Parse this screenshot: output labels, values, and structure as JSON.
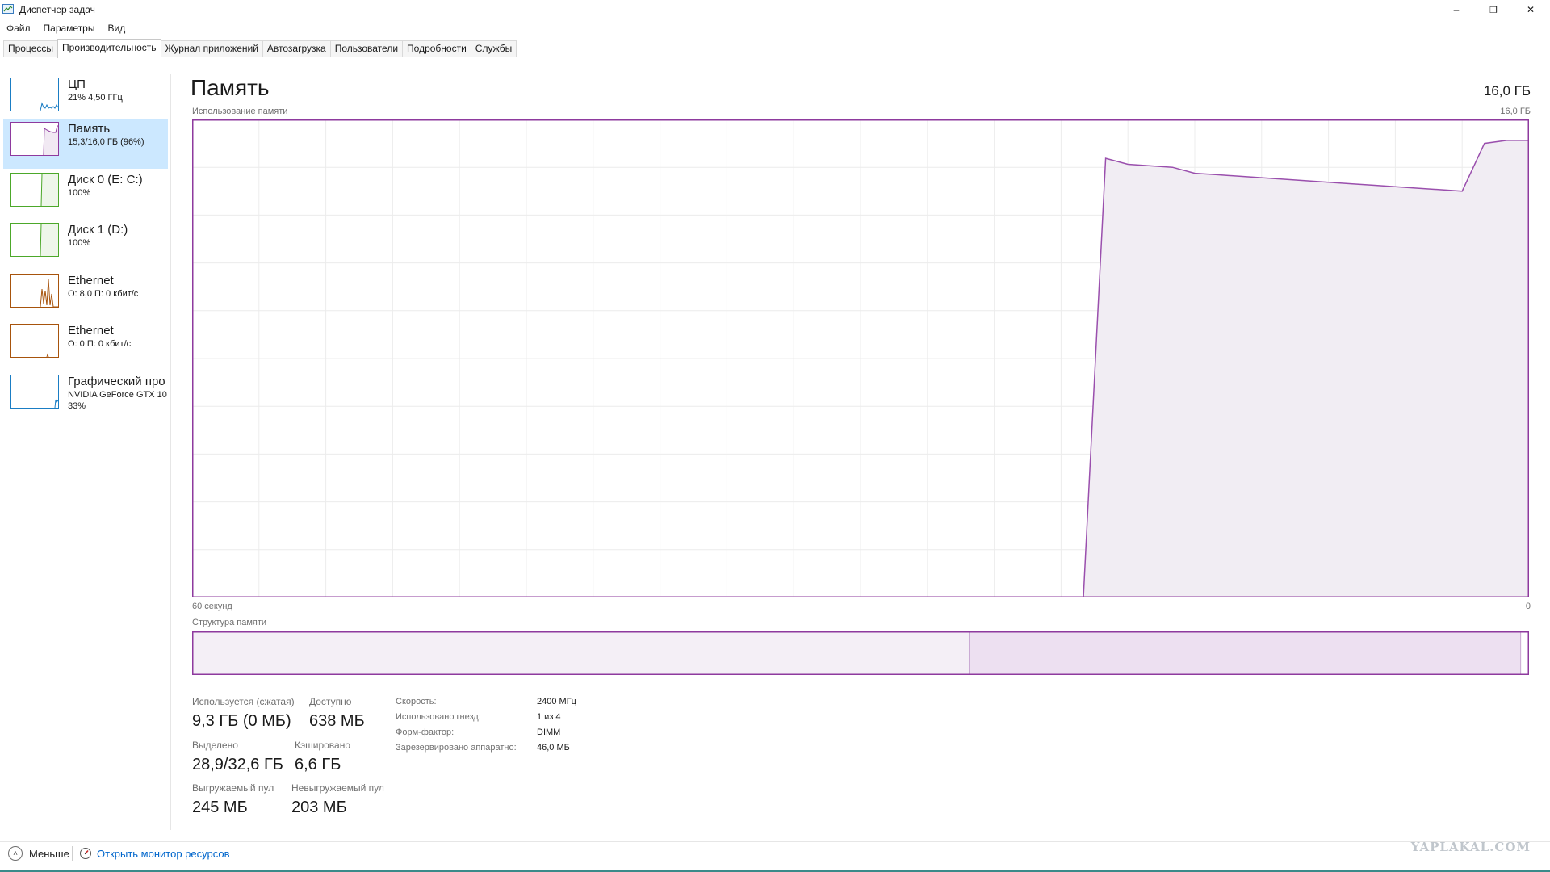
{
  "window": {
    "title": "Диспетчер задач",
    "minimize": "–",
    "restore": "❐",
    "close": "✕"
  },
  "menu": [
    "Файл",
    "Параметры",
    "Вид"
  ],
  "tabs": [
    {
      "label": "Процессы",
      "active": false
    },
    {
      "label": "Производительность",
      "active": true
    },
    {
      "label": "Журнал приложений",
      "active": false
    },
    {
      "label": "Автозагрузка",
      "active": false
    },
    {
      "label": "Пользователи",
      "active": false
    },
    {
      "label": "Подробности",
      "active": false
    },
    {
      "label": "Службы",
      "active": false
    }
  ],
  "sidebar": {
    "items": [
      {
        "title": "ЦП",
        "sub": "21% 4,50 ГГц",
        "sub2": "",
        "color": "#1a7dc4",
        "selected": false
      },
      {
        "title": "Память",
        "sub": "15,3/16,0 ГБ (96%)",
        "sub2": "",
        "color": "#8e3a9e",
        "selected": true
      },
      {
        "title": "Диск 0 (E: C:)",
        "sub": "100%",
        "sub2": "",
        "color": "#4ca82a",
        "selected": false
      },
      {
        "title": "Диск 1 (D:)",
        "sub": "100%",
        "sub2": "",
        "color": "#4ca82a",
        "selected": false
      },
      {
        "title": "Ethernet",
        "sub": "О: 8,0 П: 0 кбит/с",
        "sub2": "",
        "color": "#a7530c",
        "selected": false
      },
      {
        "title": "Ethernet",
        "sub": "О: 0 П: 0 кбит/с",
        "sub2": "",
        "color": "#a7530c",
        "selected": false
      },
      {
        "title": "Графический про",
        "sub": "NVIDIA GeForce GTX 10",
        "sub2": "33%",
        "color": "#1a7dc4",
        "selected": false
      }
    ]
  },
  "main": {
    "title": "Память",
    "total": "16,0 ГБ",
    "usage_label": "Использование памяти",
    "usage_max": "16,0 ГБ",
    "time_left": "60 секунд",
    "time_right": "0",
    "structure_label": "Структура памяти"
  },
  "stats": {
    "in_use_label": "Используется (сжатая)",
    "in_use_value": "9,3 ГБ (0 МБ)",
    "available_label": "Доступно",
    "available_value": "638 МБ",
    "committed_label": "Выделено",
    "committed_value": "28,9/32,6 ГБ",
    "cached_label": "Кэшировано",
    "cached_value": "6,6 ГБ",
    "paged_label": "Выгружаемый пул",
    "paged_value": "245 МБ",
    "nonpaged_label": "Невыгружаемый пул",
    "nonpaged_value": "203 МБ"
  },
  "specs": [
    {
      "key": "Скорость:",
      "value": "2400 МГц"
    },
    {
      "key": "Использовано гнезд:",
      "value": "1 из 4"
    },
    {
      "key": "Форм-фактор:",
      "value": "DIMM"
    },
    {
      "key": "Зарезервировано аппаратно:",
      "value": "46,0 МБ"
    }
  ],
  "footer": {
    "fewer": "Меньше",
    "resmon": "Открыть монитор ресурсов",
    "watermark": "YAPLAKAL.COM"
  },
  "chart_data": {
    "type": "area",
    "x": [
      60,
      59,
      58,
      57,
      56,
      55,
      54,
      53,
      52,
      51,
      50,
      49,
      48,
      47,
      46,
      45,
      44,
      43,
      42,
      41,
      40,
      39,
      38,
      37,
      36,
      35,
      34,
      33,
      32,
      31,
      30,
      29,
      28,
      27,
      26,
      25,
      24,
      23,
      22,
      21,
      20,
      19,
      18,
      17,
      16,
      15,
      14,
      13,
      12,
      11,
      10,
      9,
      8,
      7,
      6,
      5,
      4,
      3,
      2,
      1,
      0
    ],
    "values": [
      0,
      0,
      0,
      0,
      0,
      0,
      0,
      0,
      0,
      0,
      0,
      0,
      0,
      0,
      0,
      0,
      0,
      0,
      0,
      0,
      0,
      0,
      0,
      0,
      0,
      0,
      0,
      0,
      0,
      0,
      0,
      0,
      0,
      0,
      0,
      0,
      0,
      0,
      0,
      0,
      0,
      14.7,
      14.5,
      14.45,
      14.4,
      14.2,
      14.15,
      14.1,
      14.05,
      14.0,
      13.95,
      13.9,
      13.85,
      13.8,
      13.75,
      13.7,
      13.65,
      13.6,
      15.2,
      15.3,
      15.3
    ],
    "xlabel": "",
    "ylabel": "",
    "ylim": [
      0,
      16
    ],
    "xlim": [
      60,
      0
    ],
    "grid": true,
    "color": "#8e3a9e"
  },
  "structure_data": {
    "in_use": 9.3,
    "modified": 0,
    "standby": 6.6,
    "free": 0.6,
    "total": 16.0
  }
}
